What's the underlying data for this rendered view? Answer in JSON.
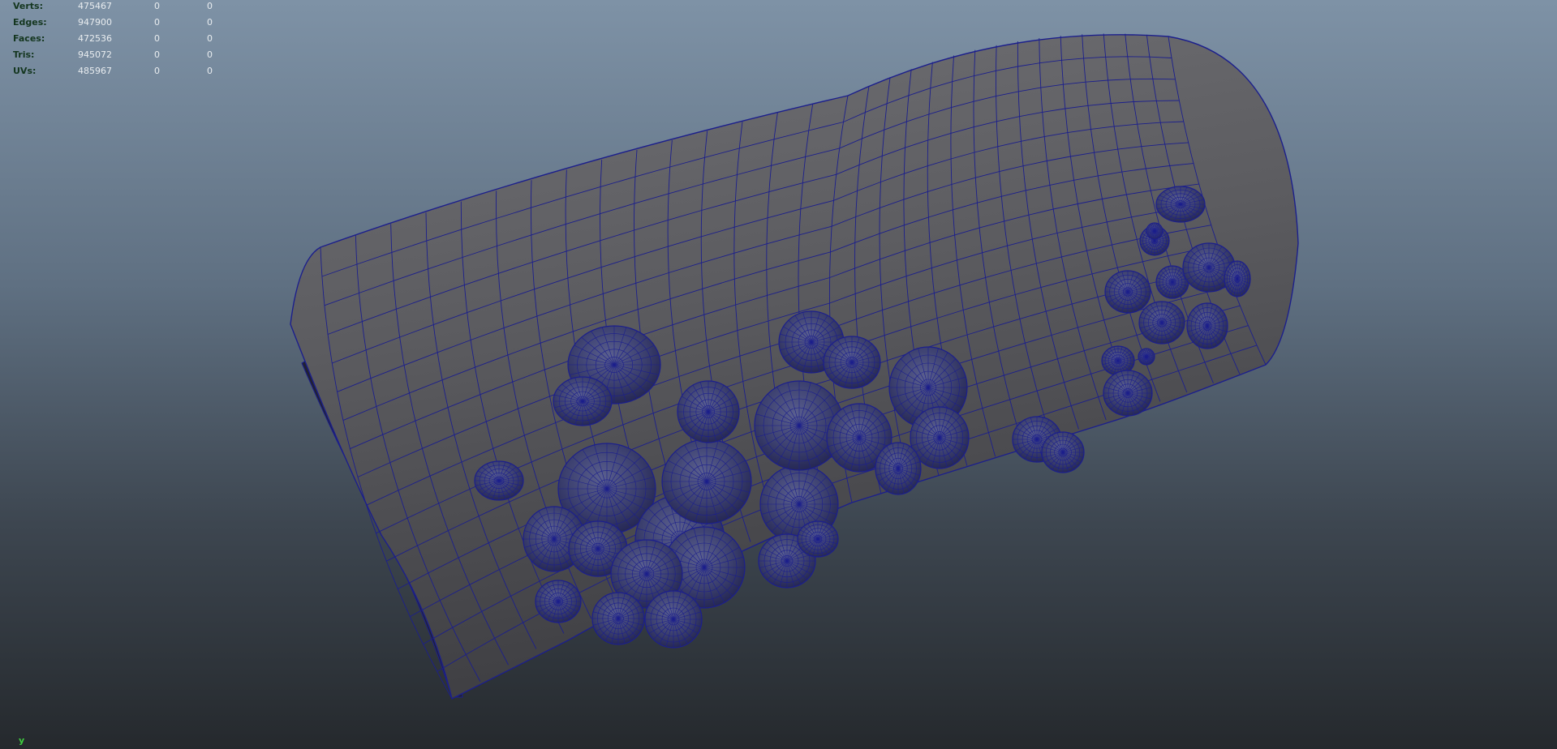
{
  "hud": {
    "rows": [
      {
        "label": "Verts:",
        "total": "475467",
        "selected": "0",
        "components": "0"
      },
      {
        "label": "Edges:",
        "total": "947900",
        "selected": "0",
        "components": "0"
      },
      {
        "label": "Faces:",
        "total": "472536",
        "selected": "0",
        "components": "0"
      },
      {
        "label": "Tris:",
        "total": "945072",
        "selected": "0",
        "components": "0"
      },
      {
        "label": "UVs:",
        "total": "485967",
        "selected": "0",
        "components": "0"
      }
    ]
  },
  "axis": {
    "label": "y"
  },
  "colors": {
    "background_top": "#7e92a6",
    "background_bottom": "#25292d",
    "mesh_fill": "#5b5b5e",
    "wireframe": "#1c1f8c",
    "hud_label": "#14361f",
    "hud_value": "#e8ecef",
    "axis_label": "#3fcf3f"
  }
}
